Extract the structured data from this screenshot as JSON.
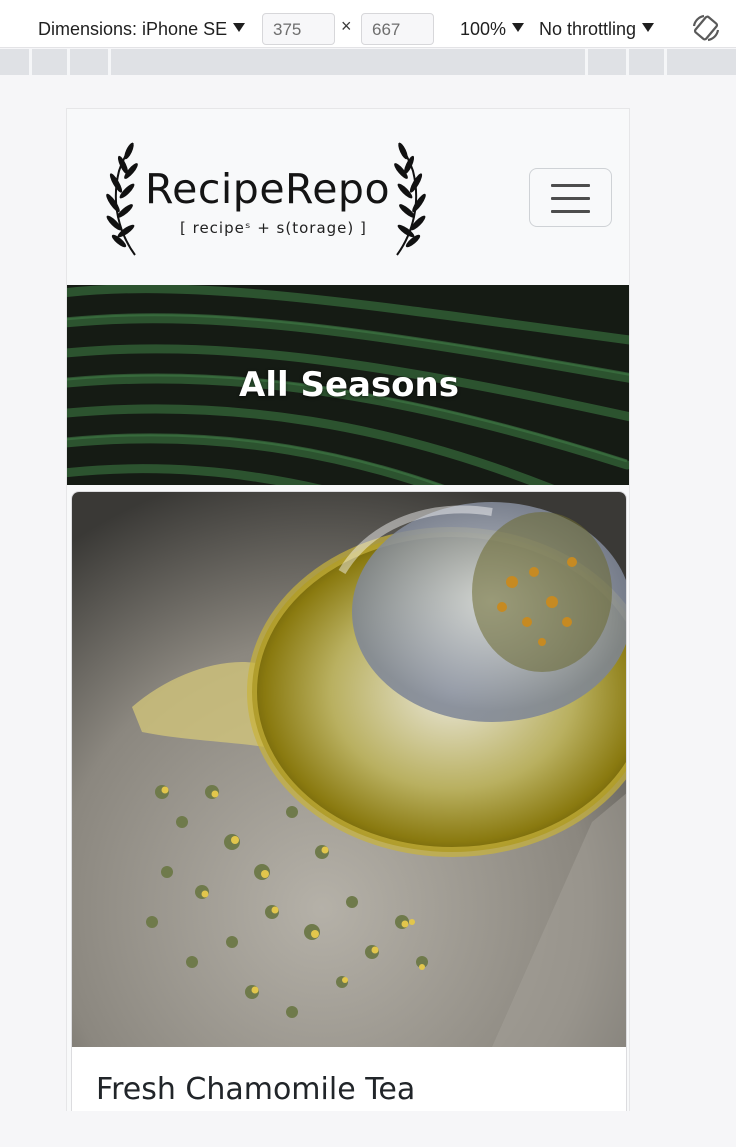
{
  "devtools": {
    "dimensions_label": "Dimensions: iPhone SE",
    "width_value": "375",
    "times_symbol": "×",
    "height_value": "667",
    "zoom_label": "100%",
    "throttling_label": "No throttling",
    "rotate_icon": "rotate-icon"
  },
  "site": {
    "logo_title": "RecipeRepo",
    "logo_subtitle": "[ recipeˢ + s(torage) ]",
    "menu_icon": "hamburger-icon"
  },
  "hero": {
    "title": "All Seasons"
  },
  "card": {
    "title": "Fresh Chamomile Tea",
    "image_subject": "glass teapot with dried chamomile flowers"
  },
  "colors": {
    "page_bg": "#f6f6f8",
    "navbar_bg": "#f8f9fa",
    "hero_bg": "#1a2219",
    "text_dark": "#212529"
  }
}
